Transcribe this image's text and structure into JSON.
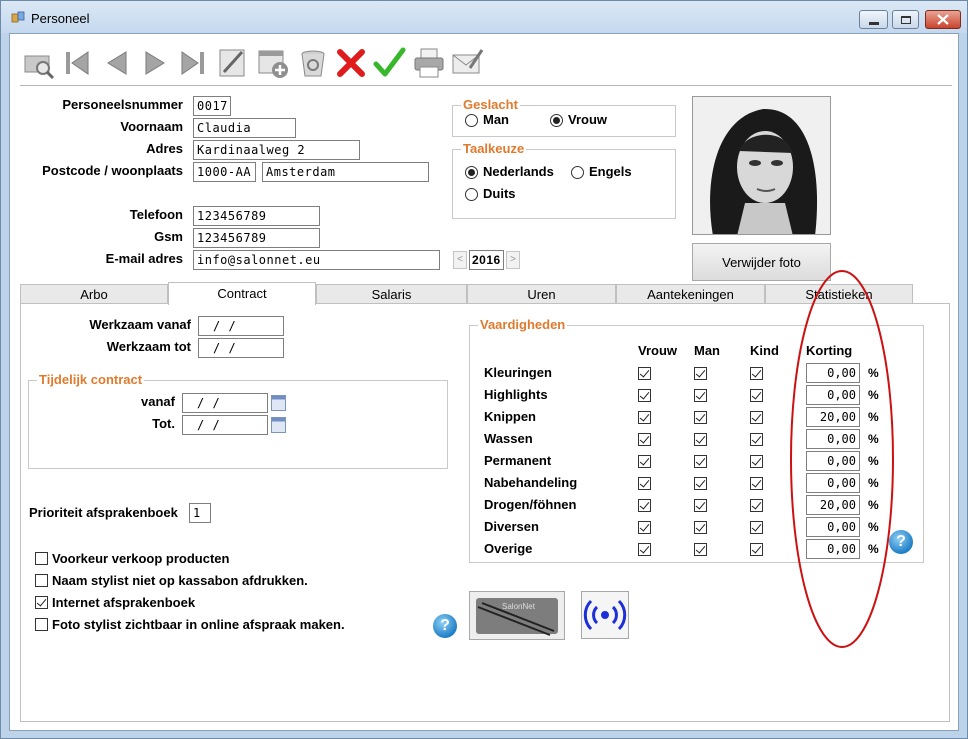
{
  "window": {
    "title": "Personeel"
  },
  "toolbar": {
    "icons": [
      "search-icon",
      "first-record-icon",
      "previous-record-icon",
      "next-record-icon",
      "last-record-icon",
      "edit-icon",
      "add-record-icon",
      "delete-record-icon",
      "cancel-icon",
      "confirm-icon",
      "print-icon",
      "email-icon"
    ]
  },
  "form": {
    "personeelsnummer_label": "Personeelsnummer",
    "personeelsnummer": "0017",
    "voornaam_label": "Voornaam",
    "voornaam": "Claudia",
    "adres_label": "Adres",
    "adres": "Kardinaalweg 2",
    "postcode_label": "Postcode / woonplaats",
    "postcode": "1000-AA",
    "woonplaats": "Amsterdam",
    "telefoon_label": "Telefoon",
    "telefoon": "123456789",
    "gsm_label": "Gsm",
    "gsm": "123456789",
    "email_label": "E-mail adres",
    "email": "info@salonnet.eu",
    "year": "2016",
    "year_prev": "<",
    "year_next": ">"
  },
  "geslacht": {
    "title": "Geslacht",
    "options": [
      "Man",
      "Vrouw"
    ],
    "selected": "Vrouw"
  },
  "taalkeuze": {
    "title": "Taalkeuze",
    "options": [
      "Nederlands",
      "Engels",
      "Duits"
    ],
    "selected": "Nederlands"
  },
  "photo": {
    "remove_label": "Verwijder foto"
  },
  "tabs": {
    "items": [
      "Arbo",
      "Contract",
      "Salaris",
      "Uren",
      "Aantekeningen",
      "Statistieken"
    ],
    "active": "Contract"
  },
  "contract": {
    "werkzaam_vanaf_label": "Werkzaam vanaf",
    "werkzaam_vanaf": " /  /",
    "werkzaam_tot_label": "Werkzaam tot",
    "werkzaam_tot": " /  /",
    "tijdelijk_title": "Tijdelijk contract",
    "vanaf_label": "vanaf",
    "vanaf": " /  /",
    "tot_label": "Tot.",
    "tot": " /  /",
    "prioriteit_label": "Prioriteit afsprakenboek",
    "prioriteit": "1",
    "options": [
      {
        "label": "Voorkeur verkoop producten",
        "checked": false
      },
      {
        "label": "Naam stylist niet op kassabon afdrukken.",
        "checked": false
      },
      {
        "label": "Internet afsprakenboek",
        "checked": true
      },
      {
        "label": "Foto stylist zichtbaar in online afspraak maken.",
        "checked": false
      }
    ]
  },
  "vaardigheden": {
    "title": "Vaardigheden",
    "headers": [
      "Vrouw",
      "Man",
      "Kind",
      "Korting"
    ],
    "percent_sign": "%",
    "rows": [
      {
        "name": "Kleuringen",
        "korting": "0,00"
      },
      {
        "name": "Highlights",
        "korting": "0,00"
      },
      {
        "name": "Knippen",
        "korting": "20,00"
      },
      {
        "name": "Wassen",
        "korting": "0,00"
      },
      {
        "name": "Permanent",
        "korting": "0,00"
      },
      {
        "name": "Nabehandeling",
        "korting": "0,00"
      },
      {
        "name": "Drogen/föhnen",
        "korting": "20,00"
      },
      {
        "name": "Diversen",
        "korting": "0,00"
      },
      {
        "name": "Overige",
        "korting": "0,00"
      }
    ]
  },
  "help": {
    "glyph": "?"
  },
  "salonnet_logo_text": "SalonNet",
  "colors": {
    "group_title": "#e07a2e",
    "annotation_red": "#cc1111"
  }
}
